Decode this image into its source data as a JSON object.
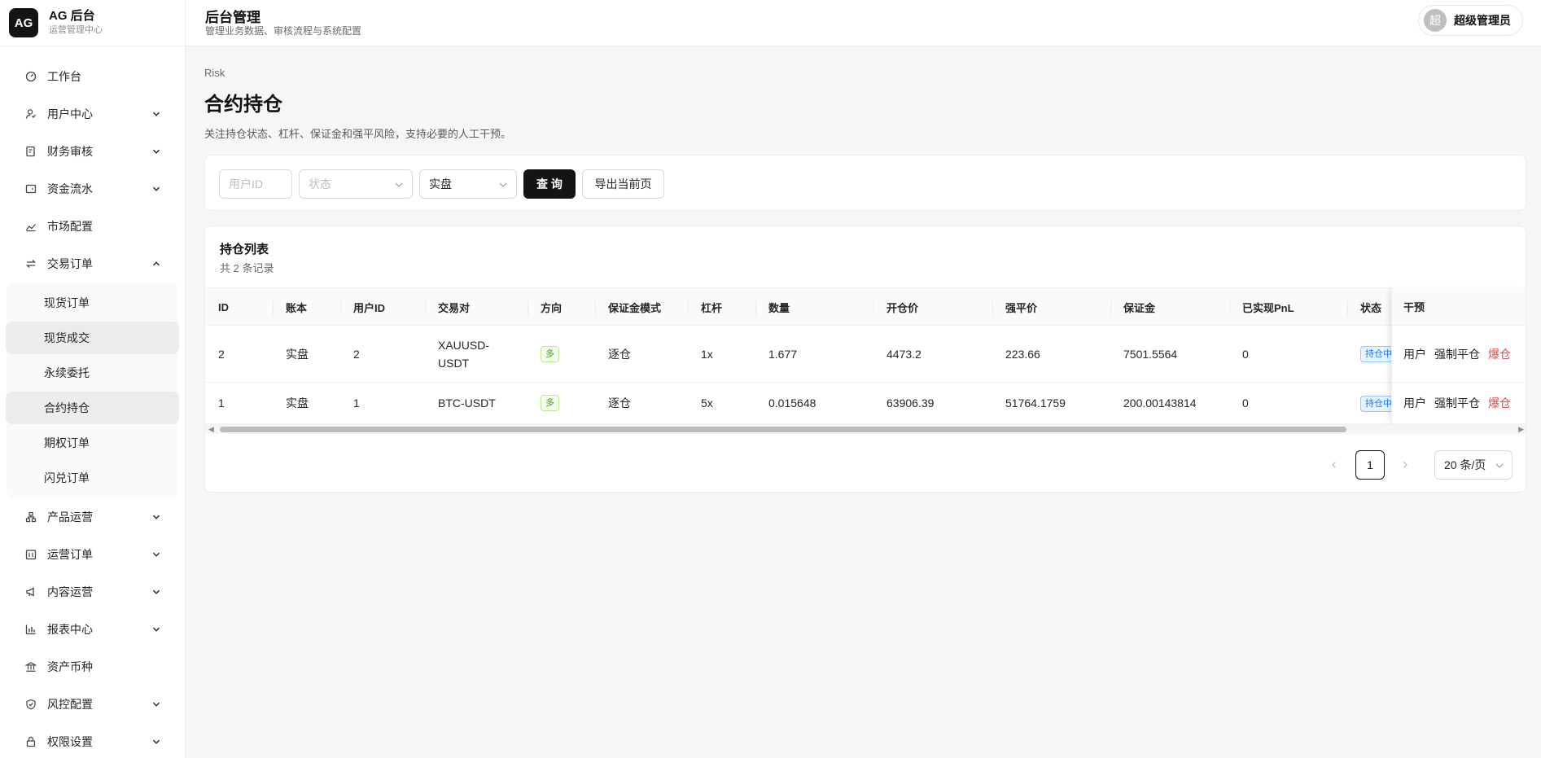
{
  "brand": {
    "logo": "AG",
    "title": "AG 后台",
    "subtitle": "运营管理中心"
  },
  "header": {
    "title": "后台管理",
    "subtitle": "管理业务数据、审核流程与系统配置",
    "user_avatar": "超",
    "user_name": "超级管理员"
  },
  "sidebar": {
    "items": [
      {
        "label": "工作台",
        "icon": "dashboard-icon"
      },
      {
        "label": "用户中心",
        "icon": "user-icon"
      },
      {
        "label": "财务审核",
        "icon": "audit-icon"
      },
      {
        "label": "资金流水",
        "icon": "wallet-icon"
      },
      {
        "label": "市场配置",
        "icon": "chart-line-icon"
      },
      {
        "label": "交易订单",
        "icon": "swap-icon"
      }
    ],
    "sub_items": [
      "现货订单",
      "现货成交",
      "永续委托",
      "合约持仓",
      "期权订单",
      "闪兑订单"
    ],
    "bottom_items": [
      {
        "label": "产品运营",
        "icon": "cluster-icon"
      },
      {
        "label": "运营订单",
        "icon": "calendar-icon"
      },
      {
        "label": "内容运营",
        "icon": "megaphone-icon"
      },
      {
        "label": "报表中心",
        "icon": "bar-chart-icon"
      },
      {
        "label": "资产币种",
        "icon": "bank-icon"
      },
      {
        "label": "风控配置",
        "icon": "shield-icon"
      },
      {
        "label": "权限设置",
        "icon": "lock-icon"
      }
    ]
  },
  "page": {
    "breadcrumb": "Risk",
    "title": "合约持仓",
    "description": "关注持仓状态、杠杆、保证金和强平风险，支持必要的人工干预。"
  },
  "filters": {
    "user_id_placeholder": "用户ID",
    "status_placeholder": "状态",
    "account_value": "实盘",
    "query_label": "查 询",
    "export_label": "导出当前页"
  },
  "table": {
    "title": "持仓列表",
    "count_text": "共 2 条记录",
    "columns": [
      "ID",
      "账本",
      "用户ID",
      "交易对",
      "方向",
      "保证金模式",
      "杠杆",
      "数量",
      "开仓价",
      "强平价",
      "保证金",
      "已实现PnL",
      "状态",
      "干预"
    ],
    "rows": [
      {
        "id": "2",
        "book": "实盘",
        "user_id": "2",
        "pair_line1": "XAUUSD-",
        "pair_line2": "USDT",
        "side": "多",
        "margin_mode": "逐仓",
        "leverage": "1x",
        "qty": "1.677",
        "open_price": "4473.2",
        "liq_price": "223.66",
        "margin": "7501.5564",
        "pnl": "0",
        "status": "持仓中"
      },
      {
        "id": "1",
        "book": "实盘",
        "user_id": "1",
        "pair_line1": "BTC-USDT",
        "pair_line2": "",
        "side": "多",
        "margin_mode": "逐仓",
        "leverage": "5x",
        "qty": "0.015648",
        "open_price": "63906.39",
        "liq_price": "51764.1759",
        "margin": "200.00143814",
        "pnl": "0",
        "status": "持仓中"
      }
    ],
    "actions": {
      "user": "用户",
      "force_close": "强制平仓",
      "liquidate": "爆仓"
    }
  },
  "pagination": {
    "current": "1",
    "page_size": "20 条/页"
  },
  "colors": {
    "accent": "#141414",
    "long_tag": "#389e0d",
    "status_tag": "#1677ff",
    "danger": "#e5484d"
  }
}
